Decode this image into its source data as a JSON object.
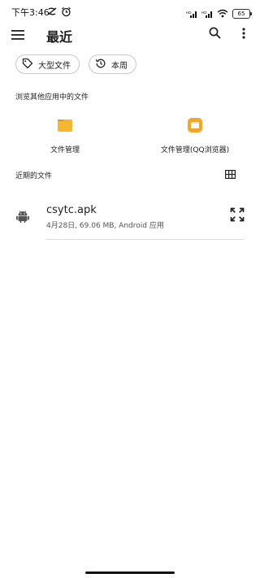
{
  "status_bar": {
    "time": "下午3:46",
    "battery": "65",
    "signal_label_1": "HD",
    "signal_label_2": "HD"
  },
  "app_bar": {
    "title": "最近"
  },
  "chips": [
    {
      "label": "大型文件",
      "icon": "tag-icon"
    },
    {
      "label": "本周",
      "icon": "history-icon"
    }
  ],
  "browse_section": {
    "label": "浏览其他应用中的文件",
    "apps": [
      {
        "label": "文件管理",
        "icon": "folder-icon",
        "color": "#F5B731"
      },
      {
        "label": "文件管理(QQ浏览器)",
        "icon": "qq-browser-folder-icon",
        "color": "#F5A623"
      }
    ]
  },
  "recent_section": {
    "label": "近期的文件"
  },
  "files": [
    {
      "name": "csytc.apk",
      "meta": "4月28日, 69.06 MB, Android 应用",
      "icon": "android-icon"
    }
  ],
  "colors": {
    "accent": "#F5B731",
    "text": "#1f1f1f",
    "divider": "#dadada"
  }
}
